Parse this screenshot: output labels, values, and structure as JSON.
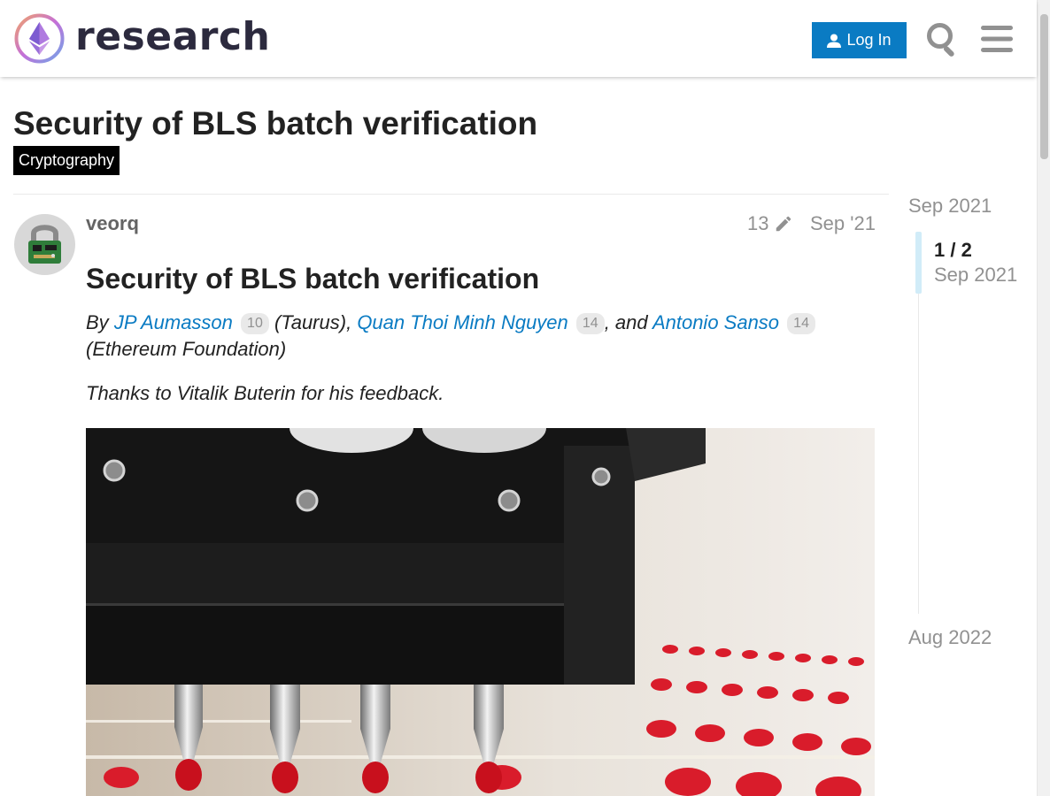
{
  "header": {
    "site_name": "research",
    "login_label": "Log In"
  },
  "topic": {
    "title": "Security of BLS batch verification",
    "category": "Cryptography",
    "category_color": "#000000"
  },
  "post": {
    "username": "veorq",
    "edit_count": "13",
    "date": "Sep '21",
    "heading": "Security of BLS batch verification",
    "byline": {
      "prefix": "By",
      "author1": "JP Aumasson",
      "author1_count": "10",
      "sep1": "(Taurus),",
      "author2": "Quan Thoi Minh Nguyen",
      "author2_count": "14",
      "sep2": ", and",
      "author3": "Antonio Sanso",
      "author3_count": "14",
      "suffix": "(Ethereum Foundation)"
    },
    "thanks": "Thanks to Vitalik Buterin for his feedback."
  },
  "timeline": {
    "start": "Sep 2021",
    "position": "1 / 2",
    "position_date": "Sep 2021",
    "end": "Aug 2022"
  },
  "colors": {
    "link": "#0a7bc3",
    "primary_button": "#0a7bc3",
    "muted_text": "#919191"
  },
  "icons": {
    "search": "search-icon",
    "menu": "hamburger-menu-icon",
    "user": "user-icon",
    "edit": "pencil-icon"
  }
}
